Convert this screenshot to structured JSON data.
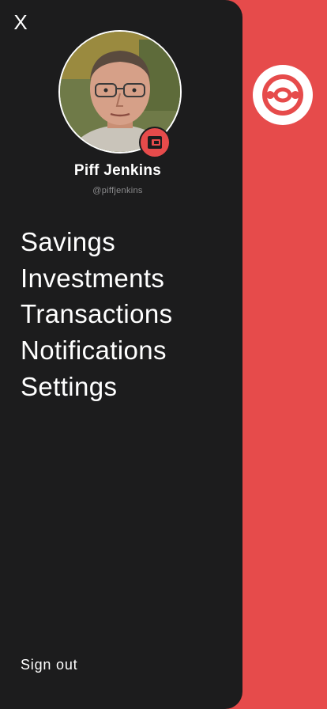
{
  "drawer": {
    "close_label": "X",
    "user": {
      "name": "Piff Jenkins",
      "handle": "@piffjenkins"
    },
    "menu": [
      {
        "label": "Savings"
      },
      {
        "label": "Investments"
      },
      {
        "label": "Transactions"
      },
      {
        "label": "Notifications"
      },
      {
        "label": "Settings"
      }
    ],
    "sign_out_label": "Sign out"
  },
  "icons": {
    "close": "close-icon",
    "avatar": "user-avatar",
    "badge": "wallet-icon",
    "brand": "brand-logo-icon"
  },
  "colors": {
    "accent": "#e64b4b",
    "drawer_bg": "#1c1c1d",
    "text_primary": "#ffffff",
    "text_secondary": "#8c8c8e"
  }
}
